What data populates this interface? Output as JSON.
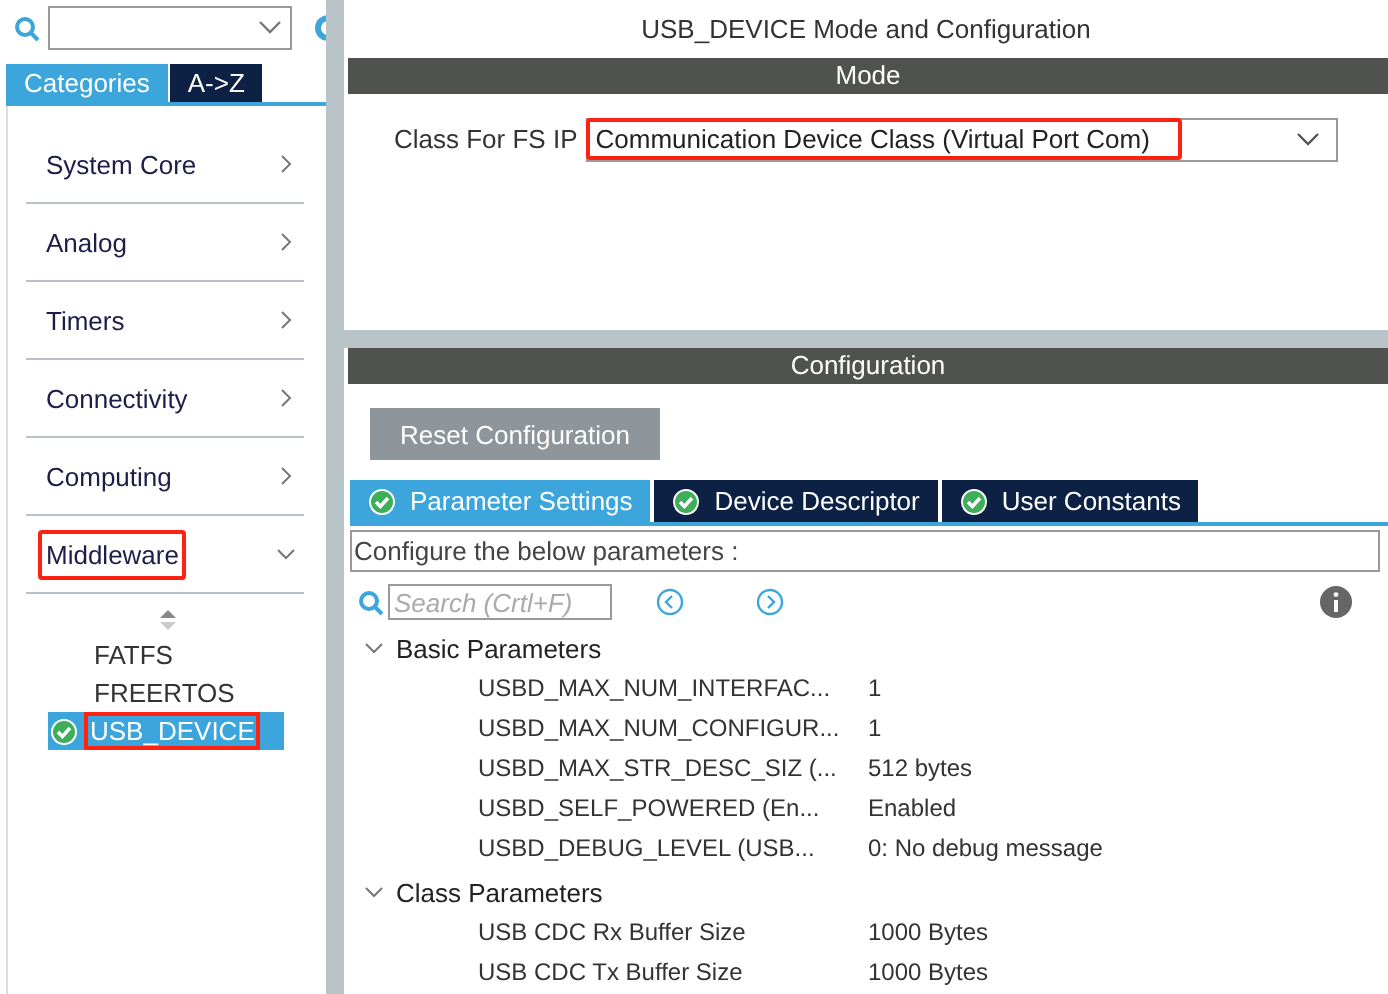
{
  "sidebar": {
    "tabs": [
      {
        "label": "Categories",
        "selected": true
      },
      {
        "label": "A->Z",
        "selected": false
      }
    ],
    "categories": [
      {
        "label": "System Core",
        "expanded": false,
        "highlighted": false
      },
      {
        "label": "Analog",
        "expanded": false,
        "highlighted": false
      },
      {
        "label": "Timers",
        "expanded": false,
        "highlighted": false
      },
      {
        "label": "Connectivity",
        "expanded": false,
        "highlighted": false
      },
      {
        "label": "Computing",
        "expanded": false,
        "highlighted": false
      },
      {
        "label": "Middleware",
        "expanded": true,
        "highlighted": true,
        "items": [
          {
            "label": "FATFS",
            "enabled": false,
            "selected": false,
            "highlighted": false
          },
          {
            "label": "FREERTOS",
            "enabled": false,
            "selected": false,
            "highlighted": false
          },
          {
            "label": "USB_DEVICE",
            "enabled": true,
            "selected": true,
            "highlighted": true
          }
        ]
      }
    ]
  },
  "main": {
    "title": "USB_DEVICE Mode and Configuration",
    "mode": {
      "header": "Mode",
      "field_label": "Class For FS IP",
      "value": "Communication Device Class (Virtual Port Com)",
      "highlighted": true
    },
    "configuration": {
      "header": "Configuration",
      "reset_button": "Reset Configuration",
      "tabs": [
        {
          "label": "Parameter Settings",
          "selected": true
        },
        {
          "label": "Device Descriptor",
          "selected": false
        },
        {
          "label": "User Constants",
          "selected": false
        }
      ],
      "hint": "Configure the below parameters :",
      "search": {
        "placeholder": "Search (Crtl+F)"
      },
      "groups": [
        {
          "label": "Basic Parameters",
          "expanded": true,
          "rows": [
            {
              "name": "USBD_MAX_NUM_INTERFAC...",
              "value": "1"
            },
            {
              "name": "USBD_MAX_NUM_CONFIGUR...",
              "value": "1"
            },
            {
              "name": "USBD_MAX_STR_DESC_SIZ (...",
              "value": "512 bytes"
            },
            {
              "name": "USBD_SELF_POWERED (En...",
              "value": "Enabled"
            },
            {
              "name": "USBD_DEBUG_LEVEL (USB...",
              "value": "0: No debug message"
            }
          ]
        },
        {
          "label": "Class Parameters",
          "expanded": true,
          "rows": [
            {
              "name": "USB CDC Rx Buffer Size",
              "value": "1000 Bytes"
            },
            {
              "name": "USB CDC Tx Buffer Size",
              "value": "1000 Bytes"
            }
          ]
        }
      ]
    }
  }
}
